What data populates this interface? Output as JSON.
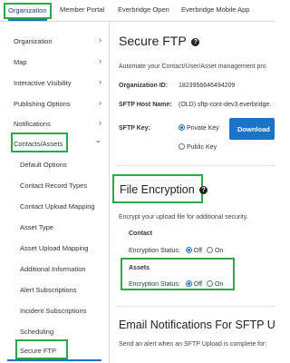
{
  "topnav": {
    "tabs": [
      "Organization",
      "Member Portal",
      "Everbridge Open",
      "Everbridge Mobile App"
    ]
  },
  "sidebar": {
    "items": [
      {
        "label": "Organization",
        "chevron": "›"
      },
      {
        "label": "Map",
        "chevron": "›"
      },
      {
        "label": "Interactive Visibility",
        "chevron": "›"
      },
      {
        "label": "Publishing Options",
        "chevron": "›"
      },
      {
        "label": "Notifications",
        "chevron": "›"
      },
      {
        "label": "Contacts/Assets",
        "chevron": "⌄"
      },
      {
        "label": "Default Options"
      },
      {
        "label": "Contact Record Types"
      },
      {
        "label": "Contact Upload Mapping"
      },
      {
        "label": "Asset Type"
      },
      {
        "label": "Asset Upload Mapping"
      },
      {
        "label": "Additional Information"
      },
      {
        "label": "Alert Subscriptions"
      },
      {
        "label": "Incident Subscriptions"
      },
      {
        "label": "Scheduling"
      },
      {
        "label": "Secure FTP"
      }
    ]
  },
  "main": {
    "title": "Secure FTP",
    "intro": "Automate your Contact/User/Asset management pro",
    "org_id_label": "Organization ID:",
    "org_id_value": "1823956646494209",
    "host_label": "SFTP Host Name:",
    "host_value": "(OLD) sftp-cont-dev3.everbridge.",
    "key_label": "SFTP Key:",
    "key_private": "Private Key",
    "key_public": "Public Key",
    "download_label": "Download",
    "encryption": {
      "title": "File Encryption",
      "desc": "Encrypt your upload file for additional security.",
      "contact_heading": "Contact",
      "assets_heading": "Assets",
      "status_label": "Encryption Status:",
      "off": "Off",
      "on": "On"
    },
    "email_title": "Email Notifications For SFTP U",
    "email_desc": "Send an alert when an SFTP Upload is complete for:"
  },
  "colors": {
    "accent": "#1a73c9",
    "highlight": "#2aa84a"
  }
}
